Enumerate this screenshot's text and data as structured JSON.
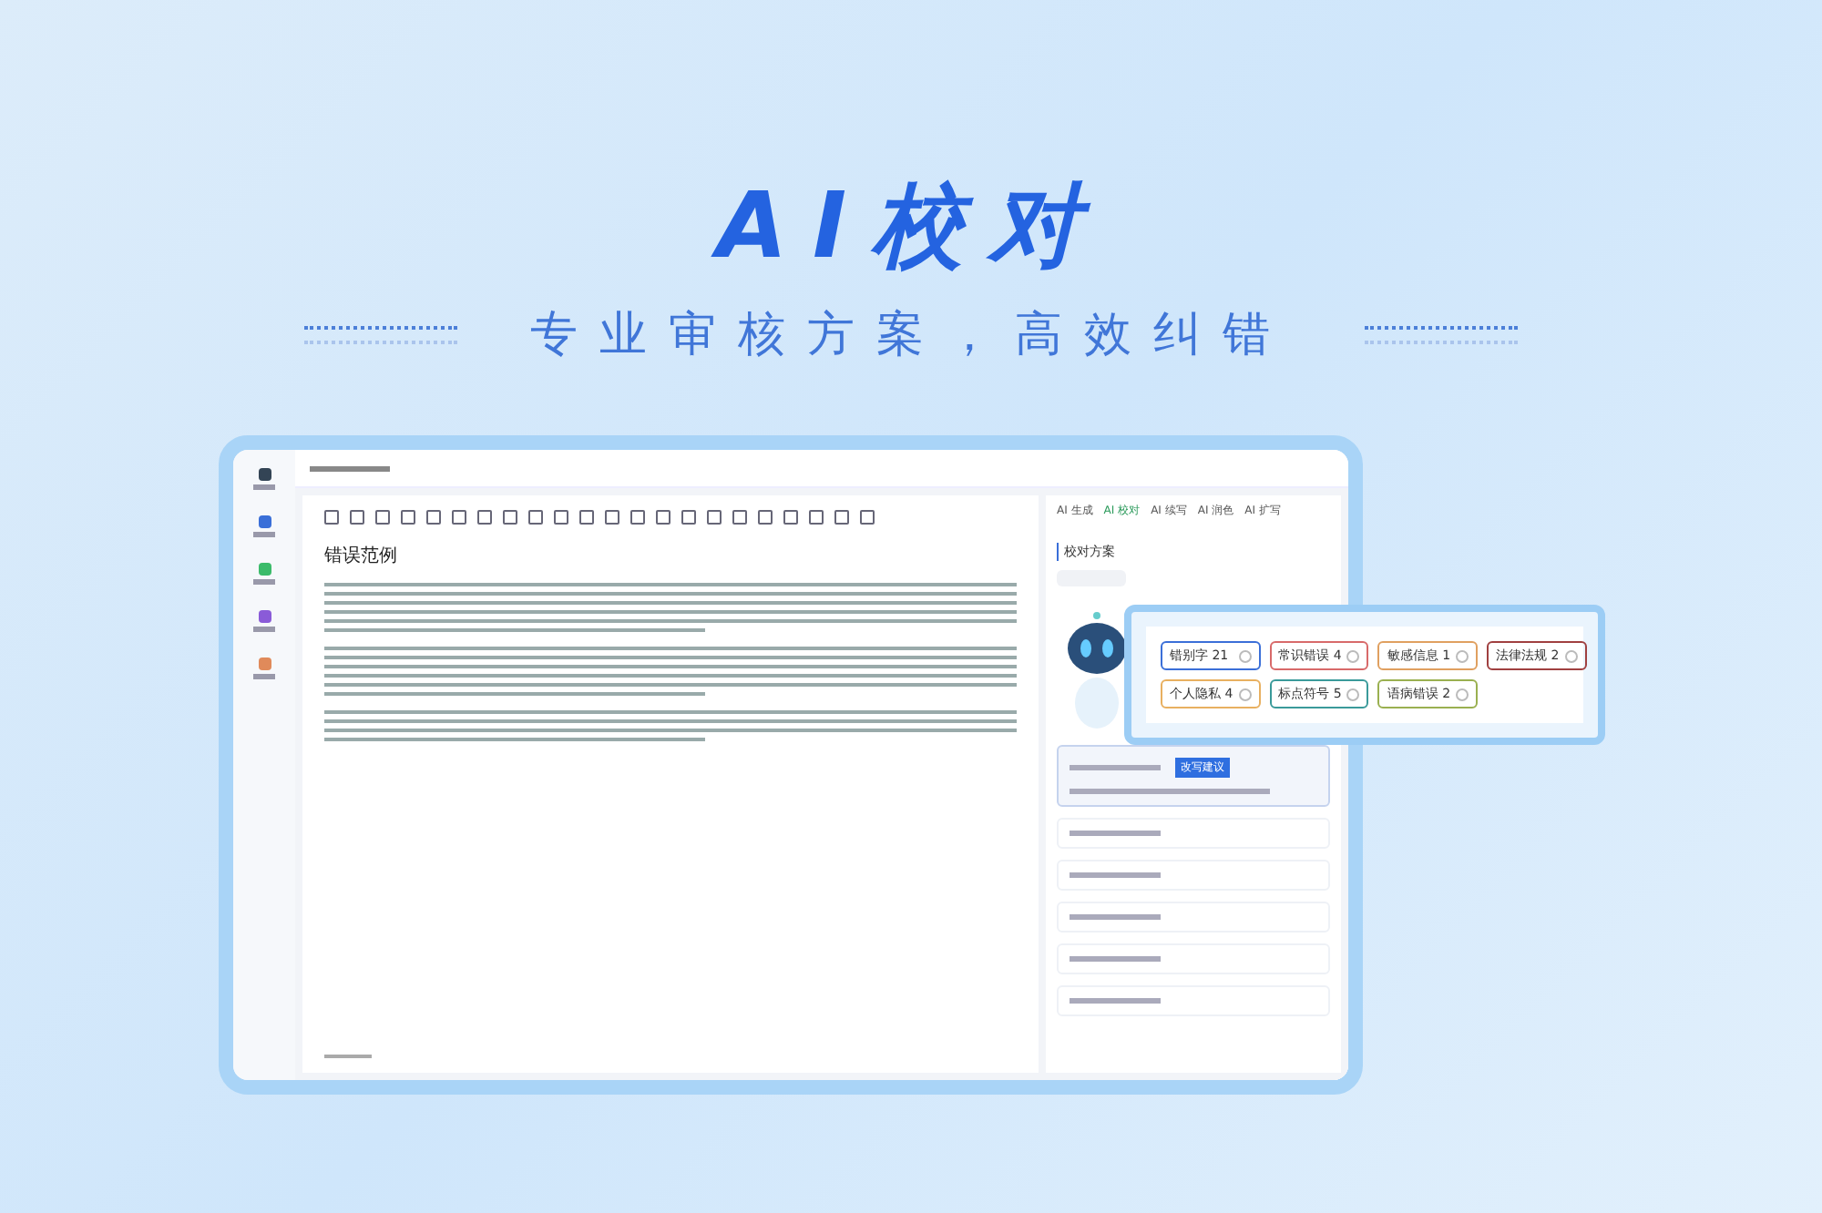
{
  "banner": {
    "title": "AI校对",
    "subtitle": "专业审核方案，高效纠错"
  },
  "document": {
    "title": "错误范例"
  },
  "ai_tabs": [
    {
      "label": "AI 生成",
      "selected": false
    },
    {
      "label": "AI 校对",
      "selected": true
    },
    {
      "label": "AI 续写",
      "selected": false
    },
    {
      "label": "AI 润色",
      "selected": false
    },
    {
      "label": "AI 扩写",
      "selected": false
    }
  ],
  "panel": {
    "title": "校对方案"
  },
  "issue_tags": [
    {
      "label": "错别字 21",
      "color": "#3b6fd8"
    },
    {
      "label": "常识错误 4",
      "color": "#d86a6a"
    },
    {
      "label": "敏感信息 1",
      "color": "#e0a060"
    },
    {
      "label": "法律法规 2",
      "color": "#a04040"
    },
    {
      "label": "个人隐私 4",
      "color": "#e8b060"
    },
    {
      "label": "标点符号 5",
      "color": "#3a9a9a"
    },
    {
      "label": "语病错误 2",
      "color": "#9ab050"
    }
  ],
  "suggestion": {
    "button": "改写建议"
  }
}
